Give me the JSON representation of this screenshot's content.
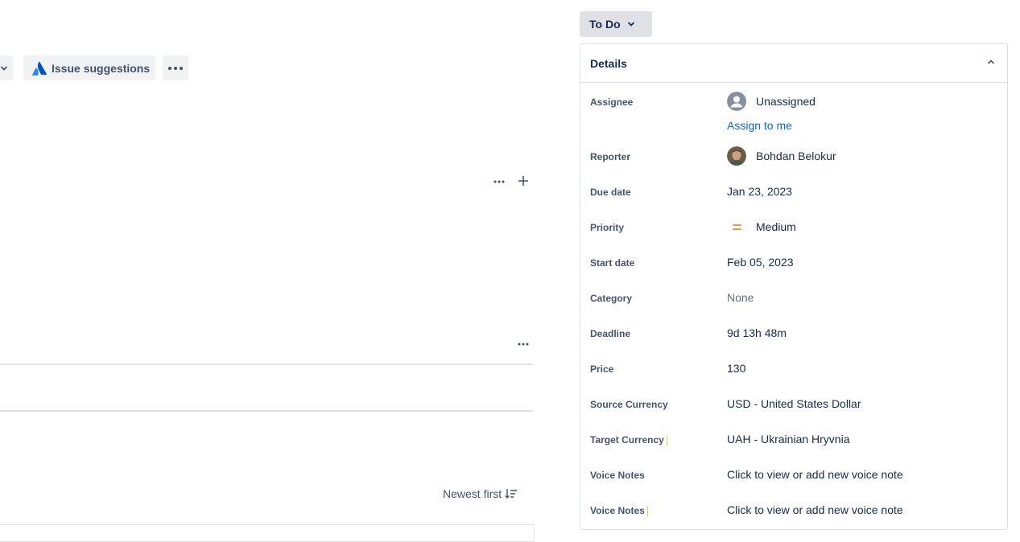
{
  "toolbar": {
    "issue_suggestions_label": "Issue suggestions"
  },
  "activity": {
    "sort_label": "Newest first"
  },
  "status": {
    "label": "To Do"
  },
  "details": {
    "title": "Details",
    "fields": [
      {
        "label": "Assignee",
        "value": "Unassigned",
        "action": "Assign to me"
      },
      {
        "label": "Reporter",
        "value": "Bohdan Belokur"
      },
      {
        "label": "Due date",
        "value": "Jan 23, 2023"
      },
      {
        "label": "Priority",
        "value": "Medium"
      },
      {
        "label": "Start date",
        "value": "Feb 05, 2023"
      },
      {
        "label": "Category",
        "value": "None"
      },
      {
        "label": "Deadline",
        "value": "9d 13h 48m"
      },
      {
        "label": "Price",
        "value": "130"
      },
      {
        "label": "Source Currency",
        "value": "USD - United States Dollar"
      },
      {
        "label": "Target Currency",
        "value": "UAH - Ukrainian Hryvnia"
      },
      {
        "label": "Voice Notes",
        "value": "Click to view or add new voice note"
      },
      {
        "label": "Voice Notes",
        "value": "Click to view or add new voice note"
      }
    ]
  },
  "colors": {
    "link": "#0c66e4",
    "priority_medium": "#f79233",
    "atlassian_blue": "#2684ff"
  },
  "icons": {
    "issue_suggestions": "atlassian-logo-icon",
    "more": "more-horizontal-icon",
    "add": "plus-icon",
    "sort": "sort-descending-icon",
    "status_chevron": "chevron-down-icon",
    "collapse": "chevron-up-icon",
    "assignee_avatar": "default-user-avatar-icon",
    "reporter_avatar": "user-photo-avatar",
    "priority": "priority-medium-icon"
  }
}
